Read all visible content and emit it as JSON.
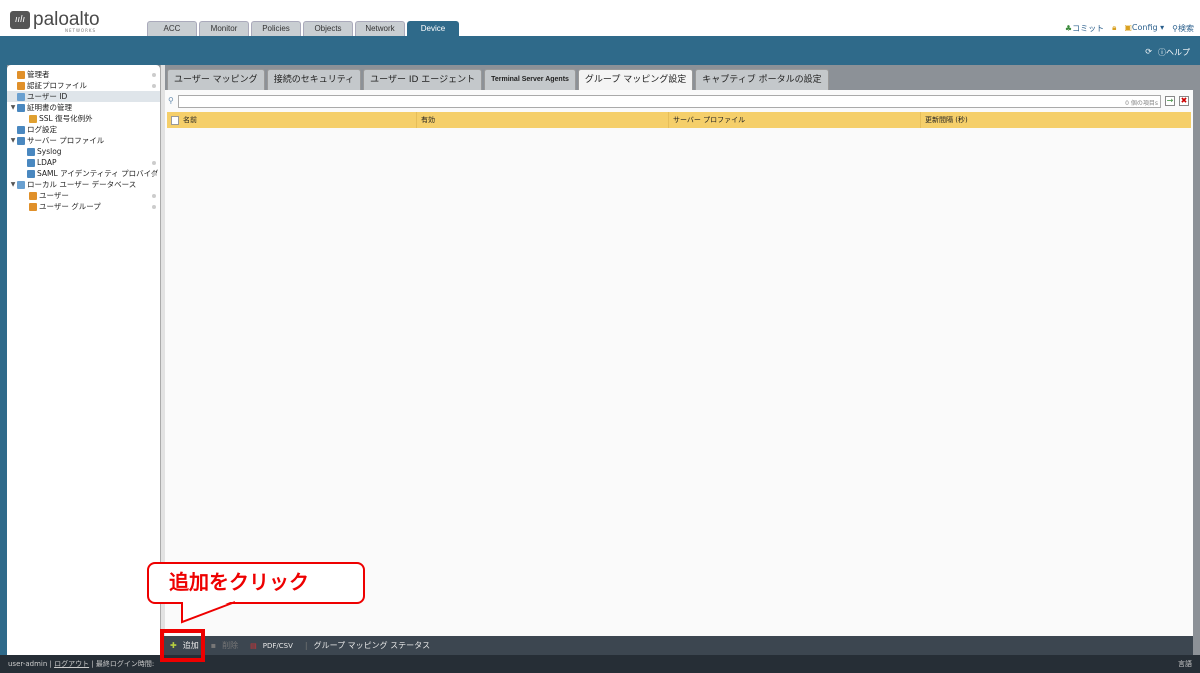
{
  "logo": {
    "text": "paloalto",
    "sub": "NETWORKS"
  },
  "main_tabs": [
    "ACC",
    "Monitor",
    "Policies",
    "Objects",
    "Network",
    "Device"
  ],
  "active_main_tab": "Device",
  "top_right": {
    "commit": "コミット",
    "config": "Config",
    "search": "検索",
    "help": "ヘルプ"
  },
  "sidebar": {
    "items": [
      {
        "label": "管理者",
        "level": 0
      },
      {
        "label": "認証プロファイル",
        "level": 0
      },
      {
        "label": "ユーザー ID",
        "level": 0,
        "selected": true
      },
      {
        "label": "証明書の管理",
        "level": 0,
        "expanded": true
      },
      {
        "label": "SSL 復号化例外",
        "level": 1
      },
      {
        "label": "ログ設定",
        "level": 0
      },
      {
        "label": "サーバー プロファイル",
        "level": 0,
        "expanded": true
      },
      {
        "label": "Syslog",
        "level": 1
      },
      {
        "label": "LDAP",
        "level": 1
      },
      {
        "label": "SAML アイデンティティ プロバイダ",
        "level": 1
      },
      {
        "label": "ローカル ユーザー データベース",
        "level": 0,
        "expanded": true
      },
      {
        "label": "ユーザー",
        "level": 1
      },
      {
        "label": "ユーザー グループ",
        "level": 1
      }
    ]
  },
  "content_tabs": [
    "ユーザー マッピング",
    "接続のセキュリティ",
    "ユーザー ID エージェント",
    "Terminal Server Agents",
    "グループ マッピング設定",
    "キャプティブ ポータルの設定"
  ],
  "active_content_tab": "グループ マッピング設定",
  "search": {
    "value": "",
    "count": "0 個の項目s"
  },
  "table": {
    "columns": [
      "名前",
      "有効",
      "サーバー プロファイル",
      "更新間隔 (秒)"
    ],
    "rows": []
  },
  "toolbar": {
    "add": "追加",
    "delete": "削除",
    "pdfcsv": "PDF/CSV",
    "status": "グループ マッピング ステータス"
  },
  "statusbar": {
    "user": "user-admin",
    "logout": "ログアウト",
    "last_login": "最終ログイン時間:",
    "language": "言語"
  },
  "callout": {
    "text": "追加をクリック"
  },
  "colors": {
    "brand": "#2f6a8a",
    "header": "#f5cf6a",
    "highlight": "#ee0000"
  }
}
